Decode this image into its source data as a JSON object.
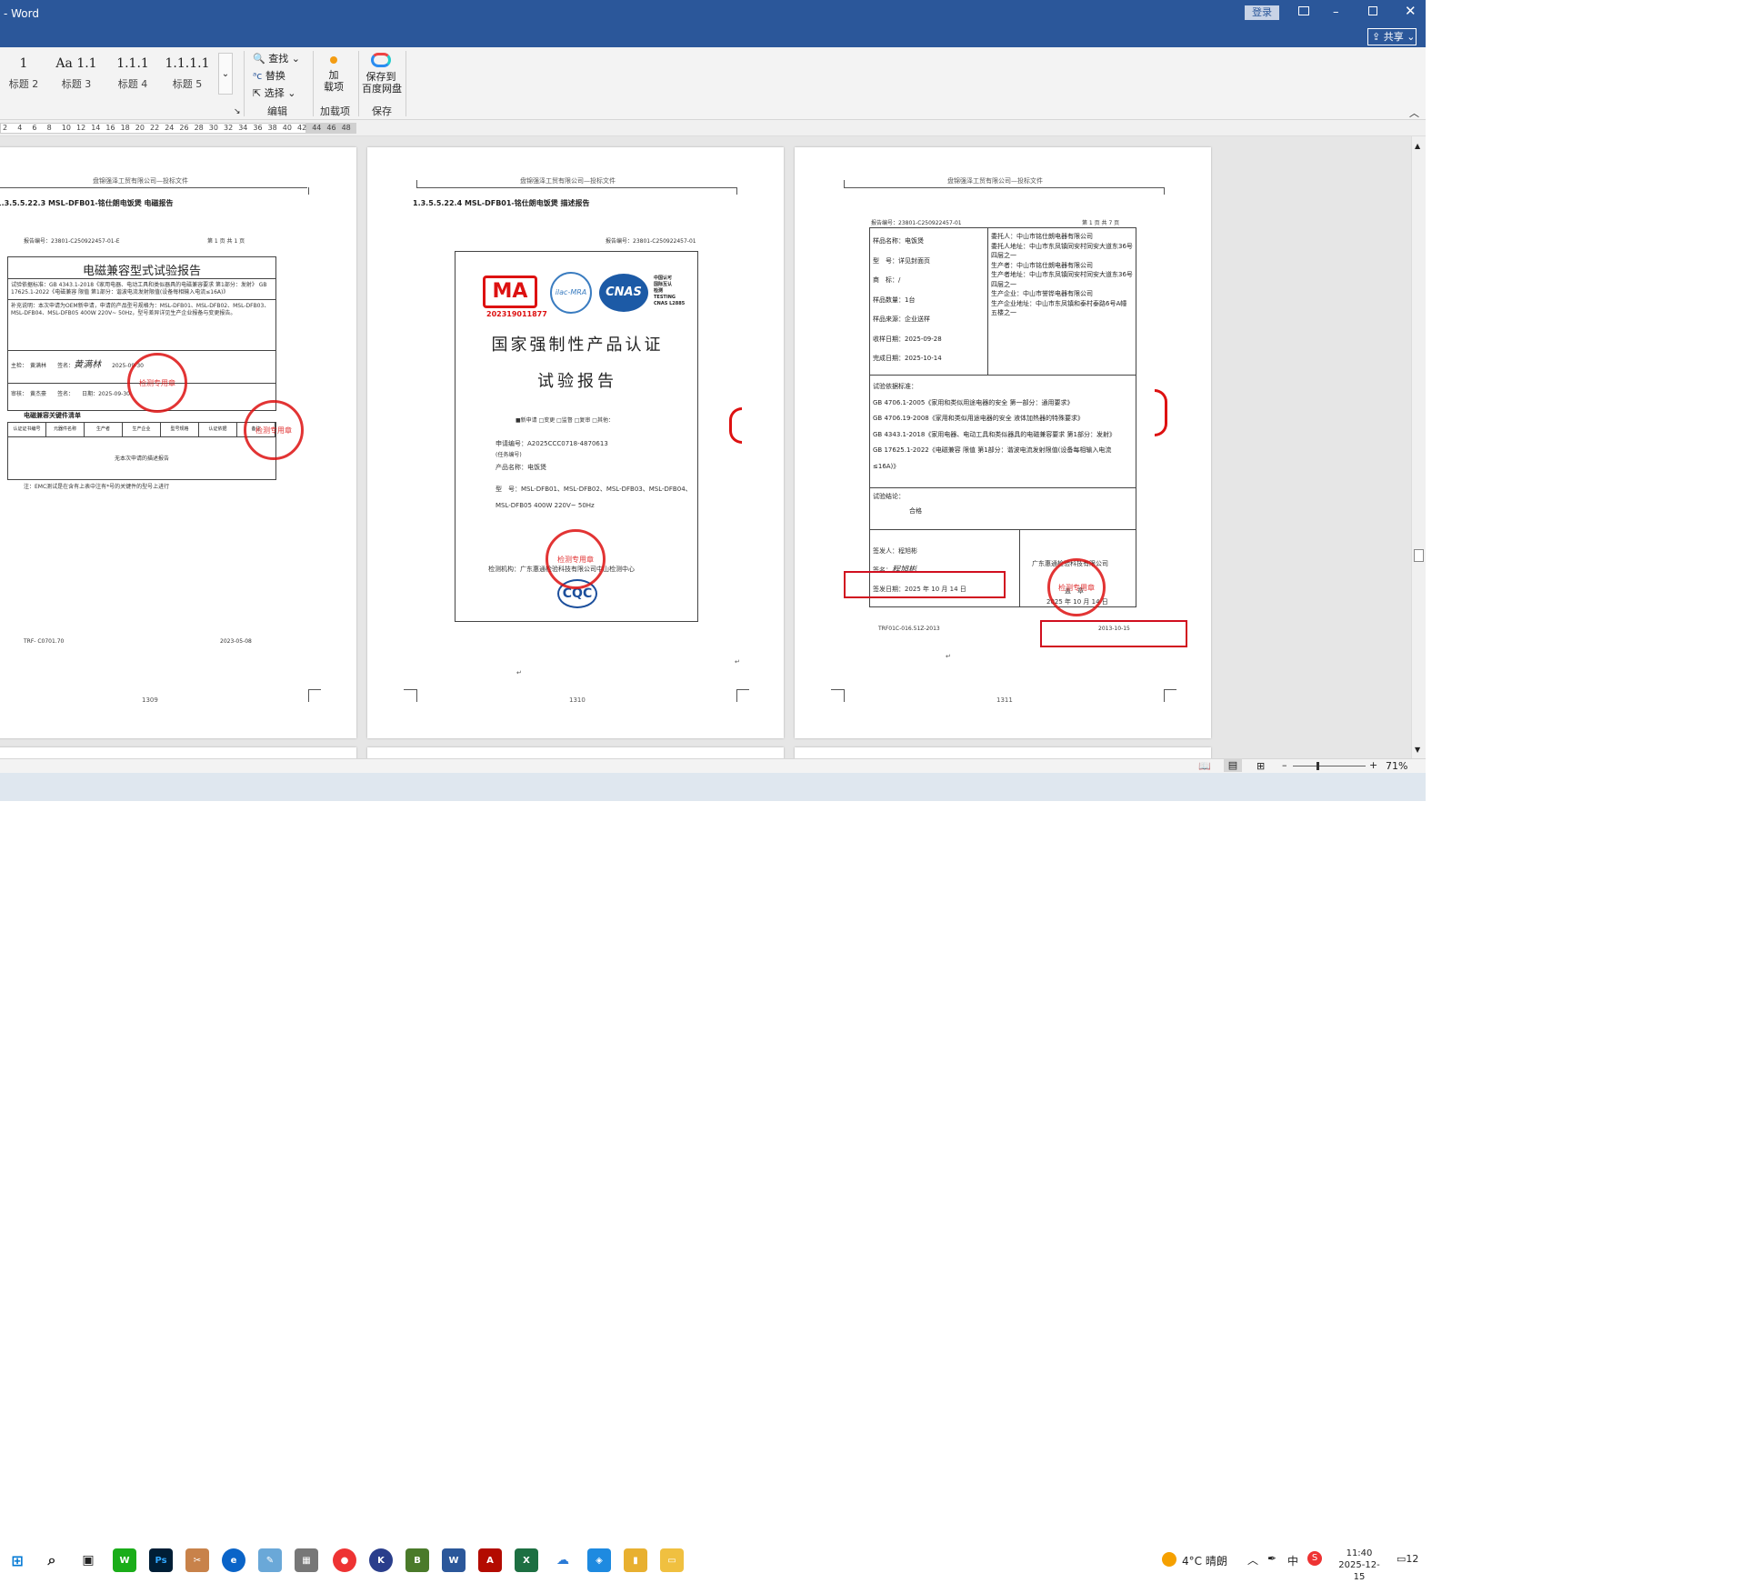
{
  "titlebar": {
    "app": "- Word",
    "login": "登录",
    "share": "共享"
  },
  "ribbon": {
    "styles": [
      {
        "preview": "1",
        "label": "标题 2"
      },
      {
        "preview": "Aa 1.1",
        "label": "标题 3"
      },
      {
        "preview": "1.1.1",
        "label": "标题 4"
      },
      {
        "preview": "1.1.1.1",
        "label": "标题 5"
      }
    ],
    "find": "查找",
    "replace": "替换",
    "select": "选择",
    "edit_group": "编辑",
    "addin_btn": "加\n载项",
    "addin_group": "加载项",
    "save_btn": "保存到\n百度网盘",
    "save_group": "保存"
  },
  "ruler": {
    "ticks": [
      "2",
      "4",
      "6",
      "8",
      "10",
      "12",
      "14",
      "16",
      "18",
      "20",
      "22",
      "24",
      "26",
      "28",
      "30",
      "32",
      "34",
      "36",
      "38",
      "40",
      "42",
      "44",
      "46",
      "48"
    ]
  },
  "pages": {
    "header": "盘锦强泽工贸有限公司—投标文件",
    "p1": {
      "heading": "1.3.5.5.22.3  MSL-DFB01-铭仕朗电饭煲 电磁报告",
      "report_no": "报告编号：23801-C250922457-01-E",
      "page": "第 1 页  共 1 页",
      "title": "电磁兼容型式试验报告",
      "std": "试验依据标准：GB 4343.1-2018《家用电器、电动工具和类似器具的电磁兼容要求 第1部分：发射》 GB 17625.1-2022《电磁兼容 限值 第1部分：谐波电流发射限值(设备每相输入电流≤16A)》",
      "note": "补充说明：本次申请为OEM新申请，申请的产品型号规格为：MSL-DFB01、MSL-DFB02、MSL-DFB03、MSL-DFB04、MSL-DFB05 400W 220V~ 50Hz，型号差异详见生产企业报备与变更报告。",
      "main": "主检：",
      "main_name": "黄满林",
      "sign": "签名：",
      "date1": "2025-09-30",
      "review": "审核：",
      "review_name": "黄杰豪",
      "date_label": "日期：",
      "date2": "2025-09-30",
      "list_title": "电磁兼容关键件清单",
      "cols": [
        "认证证书编号",
        "元器件名称",
        "生产者",
        "生产企业",
        "型号规格",
        "认证依据",
        "备注"
      ],
      "empty": "无本次申请的描述报告",
      "footnote": "注：EMC测试是在含有上表中注有*号的关键件的型号上进行",
      "foot_left": "TRF- C0701.70",
      "foot_right": "2023-05-08",
      "page_no": "1309"
    },
    "p2": {
      "heading": "1.3.5.5.22.4  MSL-DFB01-铭仕朗电饭煲 描述报告",
      "report_no": "报告编号：23801-C250922457-01",
      "ma_no": "202319011877",
      "cnas_text": "中国认可\n国际互认\n检测\nTESTING\nCNAS L2885",
      "title1": "国家强制性产品认证",
      "title2": "试验报告",
      "checks": "■新申请 □变更 □监督 □复审 □其他：",
      "app_no_label": "申请编号：",
      "app_no": "A2025CCC0718-4870613",
      "task": "(任务编号)",
      "product_label": "产品名称：",
      "product": "电饭煲",
      "model_label": "型　号：",
      "model": "MSL-DFB01、MSL-DFB02、MSL-DFB03、MSL-DFB04、MSL-DFB05 400W 220V~ 50Hz",
      "lab": "检测机构：广东惠通检验科技有限公司中山检测中心",
      "page_no": "1310"
    },
    "p3": {
      "report_no": "报告编号：23801-C250922457-01",
      "page": "第 1 页  共 7 页",
      "left": [
        "样品名称：电饭煲",
        "型　号：详见封面页",
        "商　标：/",
        "样品数量：1台",
        "样品来源：企业送样",
        "收样日期：2025-09-28",
        "完成日期：2025-10-14"
      ],
      "right": [
        "委托人：中山市铭仕朗电器有限公司",
        "委托人地址：中山市东凤镇同安村同安大道东36号四层之一",
        "生产者：中山市铭仕朗电器有限公司",
        "生产者地址：中山市东凤镇同安村同安大道东36号四层之一",
        "生产企业：中山市誉铧电器有限公司",
        "生产企业地址：中山市东凤镇和泰村泰路6号A幢五楼之一"
      ],
      "basis_title": "试验依据标准：",
      "basis": [
        "GB 4706.1-2005《家用和类似用途电器的安全 第一部分：通用要求》",
        "GB 4706.19-2008《家用和类似用途电器的安全 液体加热器的特殊要求》",
        "GB 4343.1-2018《家用电器、电动工具和类似器具的电磁兼容要求 第1部分：发射》",
        "GB 17625.1-2022《电磁兼容 限值 第1部分：谐波电流发射限值(设备每相输入电流≤16A)》"
      ],
      "concl_title": "试验结论：",
      "concl": "合格",
      "issuer": "签发人：程旭彬",
      "sign": "签名：",
      "issue_date": "签发日期：2025 年 10 月 14 日",
      "company": "广东惠通检验科技有限公司",
      "seal": "盖　章",
      "seal_date": "2025 年 10 月 14 日",
      "foot_left": "TRF01C-016.51Z-2013",
      "foot_right": "2013-10-15",
      "page_no": "1311"
    }
  },
  "status": {
    "zoom": "71%"
  },
  "taskbar": {
    "weather": "4°C 晴朗",
    "ime": "中",
    "time": "11:40",
    "date": "2025-12-15",
    "notif": "12"
  },
  "colors": {
    "word_blue": "#2b579a",
    "stamp_red": "#d11",
    "highlight_red": "#d10f1f"
  }
}
